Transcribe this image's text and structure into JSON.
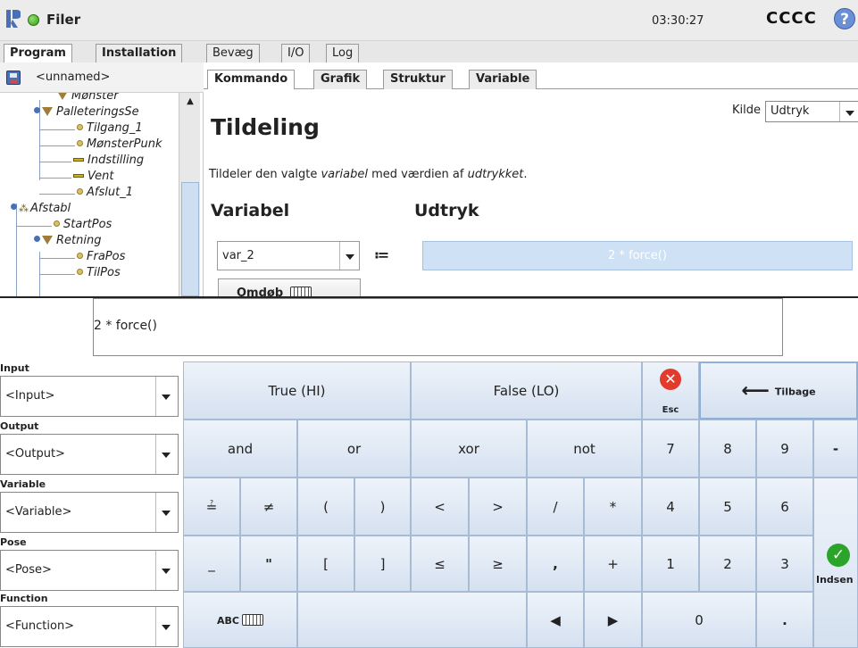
{
  "titlebar": {
    "title": "Filer",
    "clock": "03:30:27",
    "robot_name": "CCCC",
    "help": "?"
  },
  "main_tabs": [
    "Program",
    "Installation",
    "Bevæg",
    "I/O",
    "Log"
  ],
  "program": {
    "name": "<unnamed>",
    "tree": [
      "Mønster",
      "PalleteringsSe",
      "Tilgang_1",
      "MønsterPunk",
      "Indstilling",
      "Vent",
      "Afslut_1",
      "Afstabl",
      "StartPos",
      "Retning",
      "FraPos",
      "TilPos"
    ]
  },
  "sub_tabs": [
    "Kommando",
    "Grafik",
    "Struktur",
    "Variable"
  ],
  "command": {
    "source_label": "Kilde",
    "source_value": "Udtryk",
    "title": "Tildeling",
    "desc_pre": "Tildeler den valgte ",
    "desc_var": "variabel",
    "desc_mid": " med værdien af ",
    "desc_expr": "udtrykket",
    "desc_post": ".",
    "variable_heading": "Variabel",
    "expression_heading": "Udtryk",
    "variable_value": "var_2",
    "assign_op": "≔",
    "expression_value": "2 * force()",
    "rename_label": "Omdøb"
  },
  "editor": {
    "expression": "2 * force()",
    "selectors": [
      {
        "label": "Input",
        "value": "<Input>"
      },
      {
        "label": "Output",
        "value": "<Output>"
      },
      {
        "label": "Variable",
        "value": "<Variable>"
      },
      {
        "label": "Pose",
        "value": "<Pose>"
      },
      {
        "label": "Function",
        "value": "<Function>"
      }
    ],
    "keys": {
      "true": "True (HI)",
      "false": "False (LO)",
      "esc": "Esc",
      "back": "Tilbage",
      "and": "and",
      "or": "or",
      "xor": "xor",
      "not": "not",
      "n7": "7",
      "n8": "8",
      "n9": "9",
      "minus": "-",
      "eq": "≟",
      "neq": "≠",
      "lparen": "(",
      "rparen": ")",
      "lt": "<",
      "gt": ">",
      "div": "/",
      "mul": "*",
      "n4": "4",
      "n5": "5",
      "n6": "6",
      "underscore": "_",
      "quote": "\"",
      "lbracket": "[",
      "rbracket": "]",
      "le": "≤",
      "ge": "≥",
      "comma": ",",
      "plus": "+",
      "n1": "1",
      "n2": "2",
      "n3": "3",
      "abc": "ABC",
      "left": "◀",
      "right": "▶",
      "n0": "0",
      "dot": ".",
      "insert": "Indsen"
    }
  }
}
